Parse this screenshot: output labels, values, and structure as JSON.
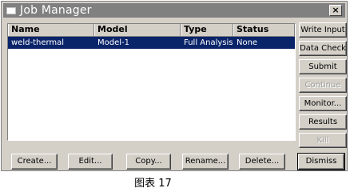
{
  "window": {
    "title": "Job Manager",
    "close_label": "×"
  },
  "table": {
    "columns": [
      "Name",
      "Model",
      "Type",
      "Status"
    ],
    "rows": [
      {
        "name": "weld-thermal",
        "model": "Model-1",
        "type": "Full Analysis",
        "status": "None",
        "selected": true
      }
    ]
  },
  "side_buttons": {
    "write_input": "Write Input",
    "data_check": "Data Check",
    "submit": "Submit",
    "continue": "Continue",
    "monitor": "Monitor...",
    "results": "Results",
    "kill": "Kill"
  },
  "bottom_buttons": {
    "create": "Create...",
    "edit": "Edit...",
    "copy": "Copy...",
    "rename": "Rename...",
    "delete": "Delete...",
    "dismiss": "Dismiss"
  },
  "caption": "图表 17",
  "colors": {
    "selection": "#0a246a",
    "title_bar": "#808080",
    "face": "#d4d0c8"
  }
}
